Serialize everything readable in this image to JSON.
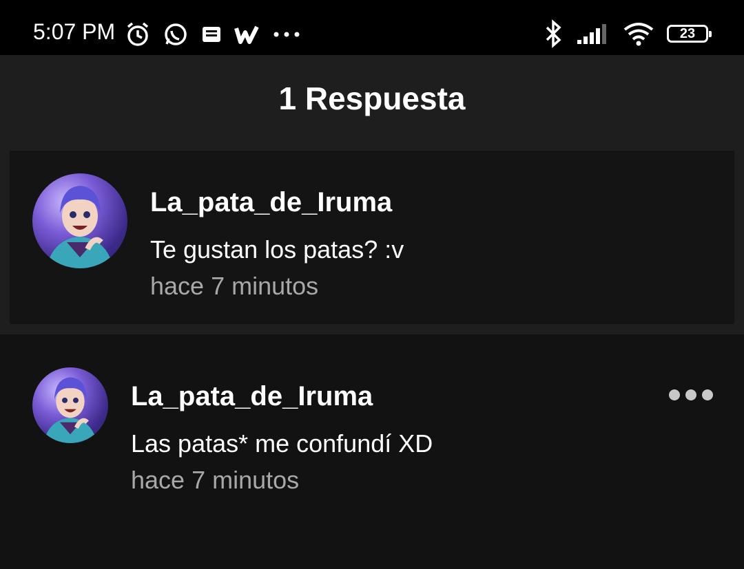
{
  "status_bar": {
    "time": "5:07 PM",
    "left_icons": [
      "alarm-icon",
      "whatsapp-icon",
      "message-icon",
      "wattpad-icon",
      "more-dots-icon"
    ],
    "battery": "23"
  },
  "header": {
    "title": "1 Respuesta"
  },
  "parent_comment": {
    "username": "La_pata_de_Iruma",
    "text": "Te gustan los patas? :v",
    "time": "hace 7 minutos"
  },
  "reply": {
    "username": "La_pata_de_Iruma",
    "text": "Las patas* me confundí XD",
    "time": "hace 7 minutos"
  }
}
